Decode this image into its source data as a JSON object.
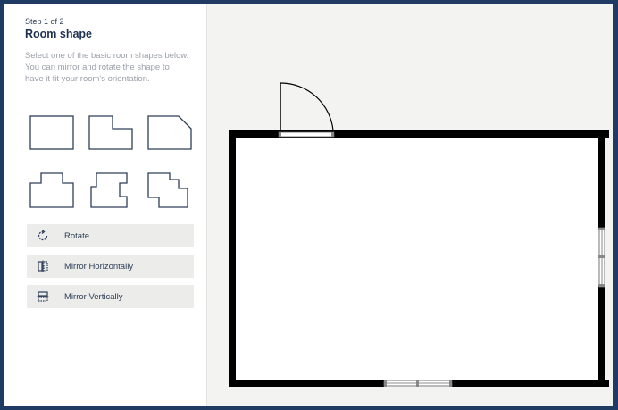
{
  "sidebar": {
    "step": "Step 1 of 2",
    "title": "Room shape",
    "description": "Select one of the basic room shapes below. You can mirror and rotate the shape to have it fit your room's orientation.",
    "shapes": [
      {
        "icon": "rectangle-room-shape"
      },
      {
        "icon": "corner-cut-room-shape"
      },
      {
        "icon": "angled-corner-room-shape"
      },
      {
        "icon": "t-room-shape"
      },
      {
        "icon": "notched-room-shape"
      },
      {
        "icon": "stepped-room-shape"
      }
    ],
    "actions": [
      {
        "label": "Rotate",
        "icon": "rotate-icon"
      },
      {
        "label": "Mirror Horizontally",
        "icon": "mirror-horizontal-icon"
      },
      {
        "label": "Mirror Vertically",
        "icon": "mirror-vertical-icon"
      }
    ]
  },
  "colors": {
    "frame": "#1f3a63",
    "canvas": "#f3f3f1",
    "wall": "#000000",
    "button": "#ececea",
    "text_dark": "#1d3050",
    "text_muted": "#9aa0a8"
  }
}
